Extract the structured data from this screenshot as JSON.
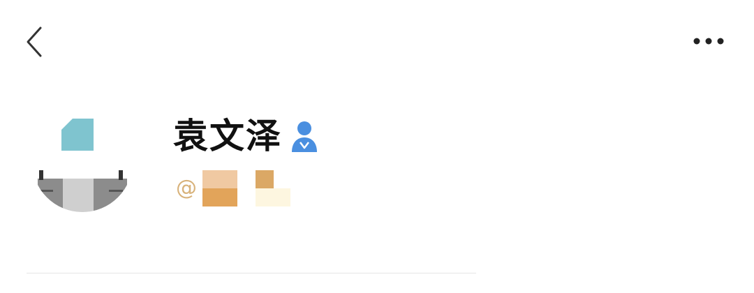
{
  "nav": {
    "back_icon": "chevron-left-icon",
    "more_icon": "more-horizontal-icon"
  },
  "profile": {
    "avatar_icon": "user-avatar",
    "display_name": "袁文泽",
    "verified_icon": "verified-user-icon",
    "verified_color": "#4a8fe0",
    "handle_prefix": "@"
  },
  "colors": {
    "handle_accent": "#d8b27a",
    "avatar_accent": "#7fc4cf"
  }
}
